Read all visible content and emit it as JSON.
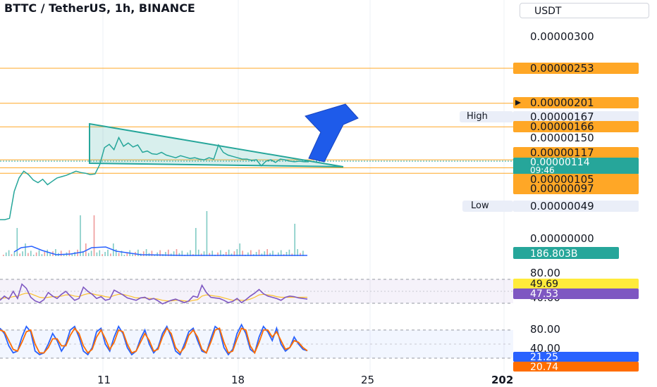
{
  "header": {
    "title": "BTTC / TetherUS, 1h, BINANCE",
    "currency": "USDT"
  },
  "colors": {
    "up": "#26a69a",
    "down": "#ef5350",
    "orange": "#ffa726",
    "green": "#26a69a",
    "triangle": "#26a69a",
    "arrow": "#1e5bea",
    "rsi": "#7e57c2",
    "rsi_ma": "#fbc02d",
    "stoch_k": "#2962ff",
    "stoch_d": "#ff6d00",
    "volume_ma": "#2962ff"
  },
  "chart_data": [
    {
      "type": "line",
      "name": "price",
      "y_scale": [
        0,
        3e-06
      ],
      "y_ticks": [
        "0.00000300",
        "0.00000150",
        "0.00000000"
      ],
      "x_ticks": [
        "11",
        "18",
        "25",
        "202"
      ],
      "series": [
        {
          "values": [
            2.8e-07,
            2.8e-07,
            3e-07,
            7e-07,
            9e-07,
            1e-06,
            9.5e-07,
            8.7e-07,
            8.3e-07,
            8.8e-07,
            8e-07,
            8.5e-07,
            9e-07,
            9.2e-07,
            9.4e-07,
            9.7e-07,
            1e-06,
            9.8e-07,
            9.7e-07,
            9.5e-07,
            9.6e-07,
            1.1e-06,
            1.35e-06,
            1.4e-06,
            1.32e-06,
            1.5e-06,
            1.37e-06,
            1.42e-06,
            1.36e-06,
            1.39e-06,
            1.28e-06,
            1.3e-06,
            1.26e-06,
            1.25e-06,
            1.28e-06,
            1.24e-06,
            1.22e-06,
            1.2e-06,
            1.23e-06,
            1.21e-06,
            1.19e-06,
            1.2e-06,
            1.18e-06,
            1.17e-06,
            1.2e-06,
            1.18e-06,
            1.39e-06,
            1.28e-06,
            1.24e-06,
            1.22e-06,
            1.2e-06,
            1.18e-06,
            1.18e-06,
            1.16e-06,
            1.17e-06,
            1.08e-06,
            1.15e-06,
            1.17e-06,
            1.13e-06,
            1.18e-06,
            1.17e-06,
            1.15e-06,
            1.14e-06,
            1.15e-06,
            1.14e-06,
            1.14e-06
          ]
        }
      ],
      "horizontal_levels": [
        "0.00000253",
        "0.00000201",
        "0.00000166",
        "0.00000117",
        "0.00000105",
        "0.00000097"
      ],
      "labels": {
        "high_text": "High",
        "high_value": "0.00000167",
        "low_text": "Low",
        "low_value": "0.00000049",
        "last_value": "0.00000114",
        "countdown": "09:46",
        "level_253": "0.00000253",
        "level_201": "0.00000201",
        "level_166": "0.00000166",
        "level_117": "0.00000117",
        "level_105": "0.00000105",
        "level_097": "0.00000097"
      }
    },
    {
      "type": "bar",
      "name": "volume",
      "label": "186.803B"
    },
    {
      "type": "line",
      "name": "rsi",
      "y_ticks": [
        "80.00",
        "40.00"
      ],
      "series": [
        {
          "name": "RSI",
          "label": "47.53",
          "values": [
            45,
            52,
            47,
            60,
            48,
            72,
            65,
            50,
            44,
            41,
            46,
            58,
            52,
            48,
            55,
            60,
            52,
            45,
            48,
            67,
            60,
            55,
            48,
            51,
            45,
            47,
            62,
            58,
            54,
            49,
            47,
            45,
            49,
            50,
            46,
            48,
            44,
            39,
            42,
            45,
            47,
            44,
            41,
            44,
            52,
            50,
            70,
            58,
            50,
            49,
            48,
            45,
            41,
            43,
            48,
            41,
            46,
            52,
            57,
            63,
            56,
            52,
            50,
            48,
            45,
            50,
            52,
            51,
            49,
            48,
            47
          ]
        },
        {
          "name": "RSI MA",
          "label": "49.69",
          "values": [
            48,
            49,
            49,
            51,
            52,
            55,
            57,
            56,
            53,
            50,
            49,
            50,
            51,
            51,
            52,
            54,
            54,
            52,
            51,
            54,
            56,
            56,
            54,
            53,
            51,
            50,
            53,
            55,
            55,
            53,
            51,
            49,
            49,
            49,
            48,
            48,
            47,
            45,
            44,
            44,
            45,
            45,
            44,
            43,
            45,
            46,
            52,
            54,
            53,
            52,
            51,
            49,
            47,
            45,
            46,
            45,
            45,
            47,
            50,
            54,
            55,
            54,
            53,
            51,
            50,
            50,
            50,
            50,
            50,
            50,
            50
          ]
        }
      ]
    },
    {
      "type": "line",
      "name": "stochastic",
      "y_ticks": [
        "80.00",
        "40.00"
      ],
      "series": [
        {
          "name": "%K",
          "label": "21.25",
          "values": [
            85,
            70,
            35,
            15,
            20,
            60,
            90,
            75,
            20,
            10,
            15,
            40,
            70,
            50,
            20,
            40,
            80,
            90,
            60,
            20,
            10,
            30,
            75,
            85,
            40,
            20,
            60,
            90,
            70,
            30,
            10,
            20,
            55,
            80,
            40,
            15,
            30,
            70,
            90,
            60,
            20,
            10,
            40,
            75,
            85,
            50,
            20,
            15,
            55,
            90,
            80,
            30,
            10,
            25,
            70,
            95,
            70,
            25,
            15,
            60,
            90,
            75,
            50,
            85,
            40,
            20,
            30,
            60,
            40,
            25,
            21
          ]
        },
        {
          "name": "%D",
          "label": "20.74",
          "values": [
            80,
            75,
            50,
            25,
            20,
            45,
            75,
            80,
            40,
            15,
            15,
            30,
            55,
            55,
            35,
            35,
            65,
            85,
            70,
            35,
            15,
            25,
            60,
            80,
            55,
            25,
            45,
            80,
            75,
            40,
            15,
            20,
            45,
            70,
            50,
            20,
            25,
            60,
            85,
            70,
            30,
            15,
            30,
            65,
            80,
            60,
            25,
            15,
            45,
            80,
            85,
            45,
            15,
            20,
            55,
            85,
            80,
            35,
            15,
            45,
            80,
            80,
            60,
            75,
            50,
            25,
            30,
            50,
            45,
            30,
            21
          ]
        }
      ]
    }
  ]
}
